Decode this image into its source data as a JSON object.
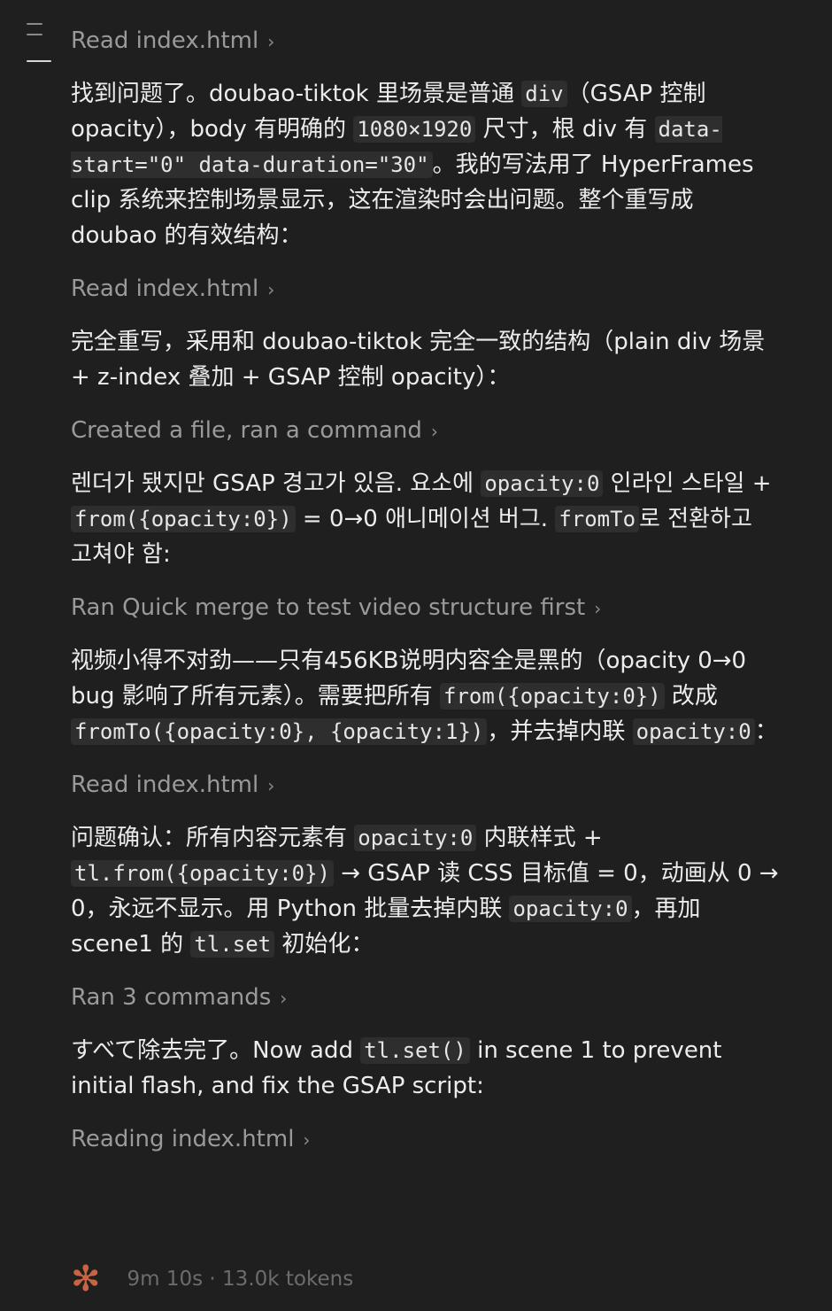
{
  "actions": {
    "a1": "Read index.html",
    "a2": "Read index.html",
    "a3": "Created a file, ran a command",
    "a4": "Ran Quick merge to test video structure first",
    "a5": "Read index.html",
    "a6": "Ran 3 commands",
    "a7": "Reading index.html",
    "chevron": "›"
  },
  "m1": {
    "t1": "找到问题了。doubao-tiktok 里场景是普通 ",
    "c1": "div",
    "t2": "（GSAP 控制 opacity），body 有明确的 ",
    "c2": "1080×1920",
    "t3": " 尺寸，根 div 有 ",
    "c3": "data-start=\"0\" data-duration=\"30\"",
    "t4": "。我的写法用了 HyperFrames clip 系统来控制场景显示，这在渲染时会出问题。整个重写成 doubao 的有效结构："
  },
  "m2": {
    "t1": "完全重写，采用和 doubao-tiktok 完全一致的结构（plain div 场景 + z-index 叠加 + GSAP 控制 opacity）："
  },
  "m3": {
    "t1": "렌더가 됐지만 GSAP 경고가 있음. 요소에 ",
    "c1": "opacity:0",
    "t2": " 인라인 스타일 + ",
    "c2": "from({opacity:0})",
    "t3": " = 0→0 애니메이션 버그. ",
    "c3": "fromTo",
    "t4": "로 전환하고 고쳐야 함:"
  },
  "m4": {
    "t1": "视频小得不对劲——只有456KB说明内容全是黑的（opacity 0→0 bug 影响了所有元素）。需要把所有 ",
    "c1": "from({opacity:0})",
    "t2": " 改成 ",
    "c2": "fromTo({opacity:0}, {opacity:1})",
    "t3": "，并去掉内联 ",
    "c3": "opacity:0",
    "t4": "："
  },
  "m5": {
    "t1": "问题确认：所有内容元素有 ",
    "c1": "opacity:0",
    "t2": " 内联样式 + ",
    "c2": "tl.from({opacity:0})",
    "t3": " → GSAP 读 CSS 目标值 = 0，动画从 0 → 0，永远不显示。用 Python 批量去掉内联 ",
    "c3": "opacity:0",
    "t4": "，再加 scene1 的 ",
    "c4": "tl.set",
    "t5": " 初始化："
  },
  "m6": {
    "t1": "すべて除去完了。Now add ",
    "c1": "tl.set()",
    "t2": " in scene 1 to prevent initial flash, and fix the GSAP script:"
  },
  "footer": {
    "spark_glyph": "✻",
    "status": "9m 10s · 13.0k tokens"
  },
  "colors": {
    "background": "#1f1f1f",
    "text": "#ececec",
    "muted": "#9a9a9a",
    "code_bg": "#2e2e2e",
    "accent": "#c96442"
  }
}
